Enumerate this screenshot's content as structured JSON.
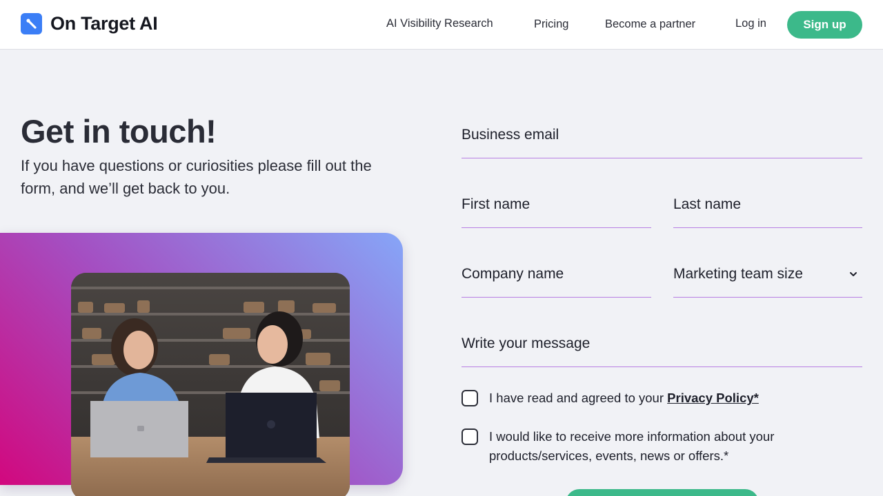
{
  "header": {
    "brand": "On Target AI",
    "nav": {
      "research": "AI Visibility Research",
      "pricing": "Pricing",
      "partner": "Become a partner",
      "login": "Log in"
    },
    "signup": "Sign up"
  },
  "hero": {
    "title": "Get in touch!",
    "subtitle": "If you have questions or curiosities please fill out the form, and we’ll get back to you."
  },
  "form": {
    "business_email": "Business email",
    "first_name": "First name",
    "last_name": "Last name",
    "company_name": "Company name",
    "team_size": "Marketing team size",
    "message": "Write your message",
    "consent_privacy_prefix": "I have read and agreed to your ",
    "consent_privacy_link": "Privacy Policy*",
    "consent_marketing": "I would like to receive more information about your products/services, events, news or offers.*"
  },
  "colors": {
    "brand_blue": "#3b7ef6",
    "accent_green": "#3cb98a",
    "field_underline": "#b77ee2",
    "gradient_start": "#d2087e",
    "gradient_end": "#86a6f8"
  },
  "icons": [
    "pen-logo-icon",
    "chevron-down-icon"
  ]
}
